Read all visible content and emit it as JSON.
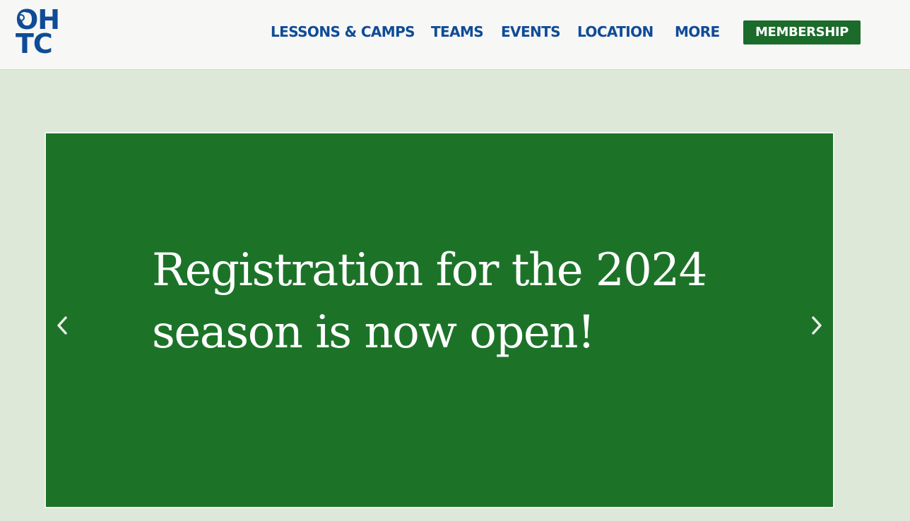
{
  "logo": {
    "line1": "OH",
    "line2": "TC",
    "color": "#0f4c97"
  },
  "nav": {
    "items": [
      {
        "label": "LESSONS & CAMPS"
      },
      {
        "label": "TEAMS"
      },
      {
        "label": "EVENTS"
      },
      {
        "label": "LOCATION"
      },
      {
        "label": "MORE"
      }
    ],
    "membership_label": "MEMBERSHIP"
  },
  "slider": {
    "text_line1": "Registration for the 2024",
    "text_line2": "season is now open!",
    "prev_icon": "chevron-left-icon",
    "next_icon": "chevron-right-icon"
  },
  "colors": {
    "brand_blue": "#0f4c97",
    "brand_green": "#1b6b2a",
    "slide_green": "#1c7328",
    "page_bg": "#dde8d8",
    "header_bg": "#f7f7f5"
  }
}
